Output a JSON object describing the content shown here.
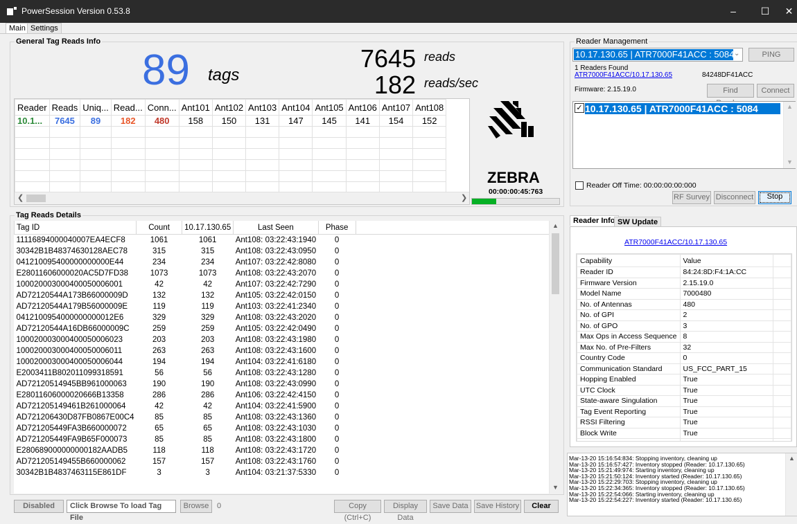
{
  "window": {
    "title": "PowerSession  Version 0.53.8"
  },
  "tabs": [
    "Main",
    "Settings"
  ],
  "general": {
    "title": "General Tag Reads Info",
    "tags_count": "89",
    "tags_label": "tags",
    "reads_count": "7645",
    "reads_label": "reads",
    "rate_count": "182",
    "rate_label": "reads/sec",
    "grid_headers": [
      "Reader",
      "Reads",
      "Uniq...",
      "Read...",
      "Conn...",
      "Ant101",
      "Ant102",
      "Ant103",
      "Ant104",
      "Ant105",
      "Ant106",
      "Ant107",
      "Ant108"
    ],
    "grid_row": [
      "10.1...",
      "7645",
      "89",
      "182",
      "480",
      "158",
      "150",
      "131",
      "147",
      "145",
      "141",
      "154",
      "152"
    ],
    "logo_text": "ZEBRA",
    "elapsed": "00:00:00:45:763",
    "progress": 0.28
  },
  "details": {
    "title": "Tag Reads Details",
    "headers": [
      "Tag ID",
      "Count",
      "10.17.130.65",
      "Last Seen",
      "Phase"
    ],
    "rows": [
      [
        "11116894000040007EA4ECF8",
        "1061",
        "1061",
        "Ant108: 03:22:43:1940",
        "0"
      ],
      [
        "30342B1B48374630128AEC78",
        "315",
        "315",
        "Ant108: 03:22:43:0950",
        "0"
      ],
      [
        "041210095400000000000E44",
        "234",
        "234",
        "Ant107: 03:22:42:8080",
        "0"
      ],
      [
        "E28011606000020AC5D7FD38",
        "1073",
        "1073",
        "Ant108: 03:22:43:2070",
        "0"
      ],
      [
        "100020003000400050006001",
        "42",
        "42",
        "Ant107: 03:22:42:7290",
        "0"
      ],
      [
        "AD72120544A173B66000009D",
        "132",
        "132",
        "Ant105: 03:22:42:0150",
        "0"
      ],
      [
        "AD72120544A179B56000009E",
        "119",
        "119",
        "Ant103: 03:22:41:2340",
        "0"
      ],
      [
        "0412100954000000000012E6",
        "329",
        "329",
        "Ant108: 03:22:43:2020",
        "0"
      ],
      [
        "AD72120544A16DB66000009C",
        "259",
        "259",
        "Ant105: 03:22:42:0490",
        "0"
      ],
      [
        "100020003000400050006023",
        "203",
        "203",
        "Ant108: 03:22:43:1980",
        "0"
      ],
      [
        "100020003000400050006011",
        "263",
        "263",
        "Ant108: 03:22:43:1600",
        "0"
      ],
      [
        "100020003000400050006044",
        "194",
        "194",
        "Ant104: 03:22:41:6180",
        "0"
      ],
      [
        "E2003411B802011099318591",
        "56",
        "56",
        "Ant108: 03:22:43:1280",
        "0"
      ],
      [
        "AD72120514945BB961000063",
        "190",
        "190",
        "Ant108: 03:22:43:0990",
        "0"
      ],
      [
        "E28011606000020666B13358",
        "286",
        "286",
        "Ant106: 03:22:42:4150",
        "0"
      ],
      [
        "AD721205149461B261000064",
        "42",
        "42",
        "Ant104: 03:22:41:5900",
        "0"
      ],
      [
        "AD721206430D87FB0867E00C4",
        "85",
        "85",
        "Ant108: 03:22:43:1360",
        "0"
      ],
      [
        "AD721205449FA3B660000072",
        "65",
        "65",
        "Ant108: 03:22:43:1030",
        "0"
      ],
      [
        "AD721205449FA9B65F000073",
        "85",
        "85",
        "Ant108: 03:22:43:1800",
        "0"
      ],
      [
        "E280689000000000182AADB5",
        "118",
        "118",
        "Ant108: 03:22:43:1720",
        "0"
      ],
      [
        "AD721205149455B660000062",
        "157",
        "157",
        "Ant108: 03:22:43:1760",
        "0"
      ],
      [
        "30342B1B4837463115E861DF",
        "3",
        "3",
        "Ant104: 03:21:37:5330",
        "0"
      ]
    ]
  },
  "bottom_bar": {
    "disabled_label": "Disabled",
    "tag_file_placeholder": "Click Browse To load Tag File",
    "browse_label": "Browse",
    "browse_count": "0",
    "copy_label": "Copy (Ctrl+C)",
    "display_label": "Display Data",
    "save_data_label": "Save Data",
    "save_history_label": "Save History",
    "clear_label": "Clear"
  },
  "reader_mgmt": {
    "title": "Reader Management",
    "selected_reader": "10.17.130.65  |  ATR7000F41ACC : 5084",
    "ping_label": "PING",
    "found_text": "1 Readers Found",
    "reader_link": "ATR7000F41ACC/10.17.130.65",
    "reader_id": "84248DF41ACC",
    "firmware": "Firmware: 2.15.19.0",
    "find_label": "Find Readers",
    "connect_label": "Connect",
    "list_item": "10.17.130.65  |  ATR7000F41ACC : 5084",
    "off_time_label": "Reader Off Time:  00:00:00:00:000",
    "rf_survey_label": "RF Survey",
    "disconnect_label": "Disconnect",
    "stop_label": "Stop"
  },
  "reader_info": {
    "tabs": [
      "Reader Info",
      "SW Update"
    ],
    "link": "ATR7000F41ACC/10.17.130.65",
    "headers": [
      "Capability",
      "Value"
    ],
    "rows": [
      [
        "Reader ID",
        "84:24:8D:F4:1A:CC"
      ],
      [
        "Firmware Version",
        "2.15.19.0"
      ],
      [
        "Model Name",
        "7000480"
      ],
      [
        "No. of Antennas",
        "480"
      ],
      [
        "No. of GPI",
        "2"
      ],
      [
        "No. of GPO",
        "3"
      ],
      [
        "Max Ops in Access Sequence",
        "8"
      ],
      [
        "Max No. of Pre-Filters",
        "32"
      ],
      [
        "Country Code",
        "0"
      ],
      [
        "Communication Standard",
        "US_FCC_PART_15"
      ],
      [
        "Hopping Enabled",
        "True"
      ],
      [
        "UTC Clock",
        "True"
      ],
      [
        "State-aware Singulation",
        "True"
      ],
      [
        "Tag Event Reporting",
        "True"
      ],
      [
        "RSSI Filtering",
        "True"
      ],
      [
        "Block Write",
        "True"
      ]
    ]
  },
  "log": [
    "Mar-13-20 15:16:54:834: Stopping inventory, cleaning up",
    "Mar-13-20 15:16:57:427: Inventory stopped (Reader: 10.17.130.65)",
    "Mar-13-20 15:21:49:974: Starting inventory, cleaning up",
    "Mar-13-20 15:21:50:124: Inventory started (Reader: 10.17.130.65)",
    "Mar-13-20 15:22:29:703: Stopping inventory, cleaning up",
    "Mar-13-20 15:22:34:365: Inventory stopped (Reader: 10.17.130.65)",
    "Mar-13-20 15:22:54:066: Starting inventory, cleaning up",
    "Mar-13-20 15:22:54:227: Inventory started (Reader: 10.17.130.65)"
  ],
  "colors": {
    "accent_blue": "#3b6fe0",
    "reader_green": "#2e8b3a",
    "rate_orange": "#e8572a",
    "conn_red": "#c0392b",
    "selection": "#0078d7",
    "progress": "#06b025"
  }
}
